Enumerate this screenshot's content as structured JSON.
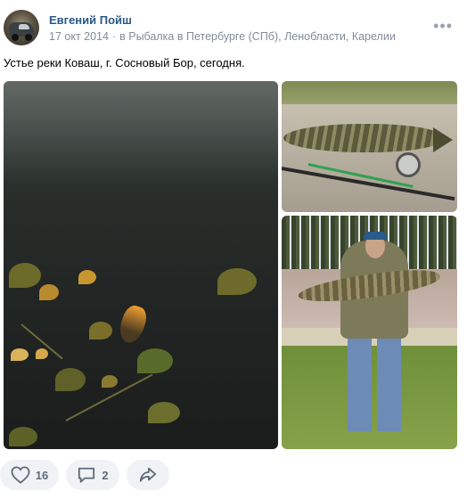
{
  "post": {
    "author": "Евгений Пойш",
    "date": "17 окт 2014",
    "separator": "·",
    "group": "в Рыбалка в Петербурге (СПб), Ленобласти, Карелии",
    "text": "Устье реки Коваш, г. Сосновый Бор, сегодня.",
    "more_icon": "more-horizontal-icon"
  },
  "photos": [
    {
      "name": "photo-ice-leaves"
    },
    {
      "name": "photo-pike-rod"
    },
    {
      "name": "photo-man-pike"
    }
  ],
  "actions": {
    "likes_count": "16",
    "comments_count": "2",
    "like_icon": "heart-icon",
    "comment_icon": "comment-icon",
    "share_icon": "share-icon"
  },
  "colors": {
    "author_link": "#2a5885",
    "meta_text": "#818c99",
    "action_bg": "#f0f2f5",
    "action_text": "#5f6b78"
  }
}
